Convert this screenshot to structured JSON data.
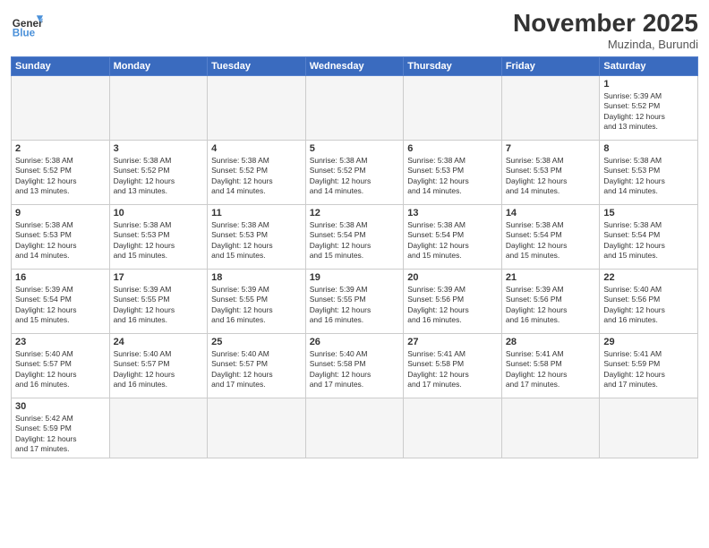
{
  "header": {
    "logo_general": "General",
    "logo_blue": "Blue",
    "month_title": "November 2025",
    "location": "Muzinda, Burundi"
  },
  "weekdays": [
    "Sunday",
    "Monday",
    "Tuesday",
    "Wednesday",
    "Thursday",
    "Friday",
    "Saturday"
  ],
  "weeks": [
    [
      {
        "day": "",
        "text": ""
      },
      {
        "day": "",
        "text": ""
      },
      {
        "day": "",
        "text": ""
      },
      {
        "day": "",
        "text": ""
      },
      {
        "day": "",
        "text": ""
      },
      {
        "day": "",
        "text": ""
      },
      {
        "day": "1",
        "text": "Sunrise: 5:39 AM\nSunset: 5:52 PM\nDaylight: 12 hours\nand 13 minutes."
      }
    ],
    [
      {
        "day": "2",
        "text": "Sunrise: 5:38 AM\nSunset: 5:52 PM\nDaylight: 12 hours\nand 13 minutes."
      },
      {
        "day": "3",
        "text": "Sunrise: 5:38 AM\nSunset: 5:52 PM\nDaylight: 12 hours\nand 13 minutes."
      },
      {
        "day": "4",
        "text": "Sunrise: 5:38 AM\nSunset: 5:52 PM\nDaylight: 12 hours\nand 14 minutes."
      },
      {
        "day": "5",
        "text": "Sunrise: 5:38 AM\nSunset: 5:52 PM\nDaylight: 12 hours\nand 14 minutes."
      },
      {
        "day": "6",
        "text": "Sunrise: 5:38 AM\nSunset: 5:53 PM\nDaylight: 12 hours\nand 14 minutes."
      },
      {
        "day": "7",
        "text": "Sunrise: 5:38 AM\nSunset: 5:53 PM\nDaylight: 12 hours\nand 14 minutes."
      },
      {
        "day": "8",
        "text": "Sunrise: 5:38 AM\nSunset: 5:53 PM\nDaylight: 12 hours\nand 14 minutes."
      }
    ],
    [
      {
        "day": "9",
        "text": "Sunrise: 5:38 AM\nSunset: 5:53 PM\nDaylight: 12 hours\nand 14 minutes."
      },
      {
        "day": "10",
        "text": "Sunrise: 5:38 AM\nSunset: 5:53 PM\nDaylight: 12 hours\nand 15 minutes."
      },
      {
        "day": "11",
        "text": "Sunrise: 5:38 AM\nSunset: 5:53 PM\nDaylight: 12 hours\nand 15 minutes."
      },
      {
        "day": "12",
        "text": "Sunrise: 5:38 AM\nSunset: 5:54 PM\nDaylight: 12 hours\nand 15 minutes."
      },
      {
        "day": "13",
        "text": "Sunrise: 5:38 AM\nSunset: 5:54 PM\nDaylight: 12 hours\nand 15 minutes."
      },
      {
        "day": "14",
        "text": "Sunrise: 5:38 AM\nSunset: 5:54 PM\nDaylight: 12 hours\nand 15 minutes."
      },
      {
        "day": "15",
        "text": "Sunrise: 5:38 AM\nSunset: 5:54 PM\nDaylight: 12 hours\nand 15 minutes."
      }
    ],
    [
      {
        "day": "16",
        "text": "Sunrise: 5:39 AM\nSunset: 5:54 PM\nDaylight: 12 hours\nand 15 minutes."
      },
      {
        "day": "17",
        "text": "Sunrise: 5:39 AM\nSunset: 5:55 PM\nDaylight: 12 hours\nand 16 minutes."
      },
      {
        "day": "18",
        "text": "Sunrise: 5:39 AM\nSunset: 5:55 PM\nDaylight: 12 hours\nand 16 minutes."
      },
      {
        "day": "19",
        "text": "Sunrise: 5:39 AM\nSunset: 5:55 PM\nDaylight: 12 hours\nand 16 minutes."
      },
      {
        "day": "20",
        "text": "Sunrise: 5:39 AM\nSunset: 5:56 PM\nDaylight: 12 hours\nand 16 minutes."
      },
      {
        "day": "21",
        "text": "Sunrise: 5:39 AM\nSunset: 5:56 PM\nDaylight: 12 hours\nand 16 minutes."
      },
      {
        "day": "22",
        "text": "Sunrise: 5:40 AM\nSunset: 5:56 PM\nDaylight: 12 hours\nand 16 minutes."
      }
    ],
    [
      {
        "day": "23",
        "text": "Sunrise: 5:40 AM\nSunset: 5:57 PM\nDaylight: 12 hours\nand 16 minutes."
      },
      {
        "day": "24",
        "text": "Sunrise: 5:40 AM\nSunset: 5:57 PM\nDaylight: 12 hours\nand 16 minutes."
      },
      {
        "day": "25",
        "text": "Sunrise: 5:40 AM\nSunset: 5:57 PM\nDaylight: 12 hours\nand 17 minutes."
      },
      {
        "day": "26",
        "text": "Sunrise: 5:40 AM\nSunset: 5:58 PM\nDaylight: 12 hours\nand 17 minutes."
      },
      {
        "day": "27",
        "text": "Sunrise: 5:41 AM\nSunset: 5:58 PM\nDaylight: 12 hours\nand 17 minutes."
      },
      {
        "day": "28",
        "text": "Sunrise: 5:41 AM\nSunset: 5:58 PM\nDaylight: 12 hours\nand 17 minutes."
      },
      {
        "day": "29",
        "text": "Sunrise: 5:41 AM\nSunset: 5:59 PM\nDaylight: 12 hours\nand 17 minutes."
      }
    ],
    [
      {
        "day": "30",
        "text": "Sunrise: 5:42 AM\nSunset: 5:59 PM\nDaylight: 12 hours\nand 17 minutes."
      },
      {
        "day": "",
        "text": ""
      },
      {
        "day": "",
        "text": ""
      },
      {
        "day": "",
        "text": ""
      },
      {
        "day": "",
        "text": ""
      },
      {
        "day": "",
        "text": ""
      },
      {
        "day": "",
        "text": ""
      }
    ]
  ]
}
